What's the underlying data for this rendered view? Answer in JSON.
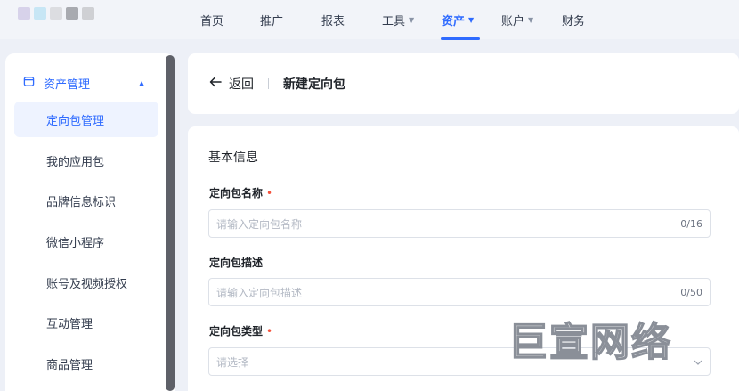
{
  "nav": {
    "items": [
      {
        "label": "首页",
        "active": false,
        "dropdown": false
      },
      {
        "label": "推广",
        "active": false,
        "dropdown": false
      },
      {
        "label": "报表",
        "active": false,
        "dropdown": false
      },
      {
        "label": "工具",
        "active": false,
        "dropdown": true
      },
      {
        "label": "资产",
        "active": true,
        "dropdown": true
      },
      {
        "label": "账户",
        "active": false,
        "dropdown": true
      },
      {
        "label": "财务",
        "active": false,
        "dropdown": false
      }
    ],
    "caret_icon": "chevron-down-icon"
  },
  "sidebar": {
    "section_label": "资产管理",
    "section_icon": "folder-icon",
    "items": [
      {
        "label": "定向包管理",
        "active": true
      },
      {
        "label": "我的应用包",
        "active": false
      },
      {
        "label": "品牌信息标识",
        "active": false
      },
      {
        "label": "微信小程序",
        "active": false
      },
      {
        "label": "账号及视频授权",
        "active": false
      },
      {
        "label": "互动管理",
        "active": false
      },
      {
        "label": "商品管理",
        "active": false
      }
    ]
  },
  "header": {
    "back_label": "返回",
    "title": "新建定向包"
  },
  "form": {
    "section_title": "基本信息",
    "name_field": {
      "label": "定向包名称",
      "placeholder": "请输入定向包名称",
      "count": "0/16"
    },
    "desc_field": {
      "label": "定向包描述",
      "placeholder": "请输入定向包描述",
      "count": "0/50"
    },
    "type_field": {
      "label": "定向包类型",
      "placeholder": "请选择"
    }
  },
  "watermark": "巨宣网络",
  "colors": {
    "accent": "#2f6bff",
    "required": "#f5533d"
  }
}
